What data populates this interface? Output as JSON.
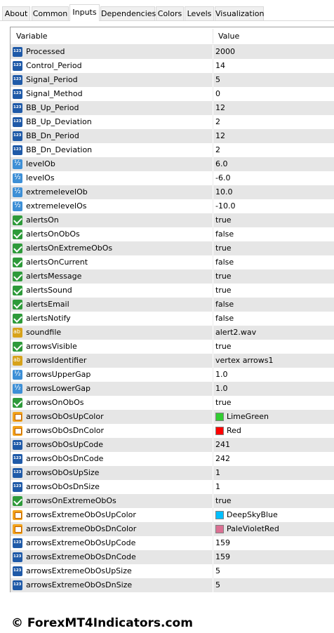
{
  "tabs": [
    {
      "label": "About",
      "active": false
    },
    {
      "label": "Common",
      "active": false
    },
    {
      "label": "Inputs",
      "active": true
    },
    {
      "label": "Dependencies",
      "active": false
    },
    {
      "label": "Colors",
      "active": false
    },
    {
      "label": "Levels",
      "active": false
    },
    {
      "label": "Visualization",
      "active": false
    }
  ],
  "table": {
    "headers": {
      "variable": "Variable",
      "value": "Value"
    },
    "rows": [
      {
        "type": "int",
        "name": "Processed",
        "value": "2000"
      },
      {
        "type": "int",
        "name": "Control_Period",
        "value": "14"
      },
      {
        "type": "int",
        "name": "Signal_Period",
        "value": "5"
      },
      {
        "type": "int",
        "name": "Signal_Method",
        "value": "0"
      },
      {
        "type": "int",
        "name": "BB_Up_Period",
        "value": "12"
      },
      {
        "type": "int",
        "name": "BB_Up_Deviation",
        "value": "2"
      },
      {
        "type": "int",
        "name": "BB_Dn_Period",
        "value": "12"
      },
      {
        "type": "int",
        "name": "BB_Dn_Deviation",
        "value": "2"
      },
      {
        "type": "double",
        "name": "levelOb",
        "value": "6.0"
      },
      {
        "type": "double",
        "name": "levelOs",
        "value": "-6.0"
      },
      {
        "type": "double",
        "name": "extremelevelOb",
        "value": "10.0"
      },
      {
        "type": "double",
        "name": "extremelevelOs",
        "value": "-10.0"
      },
      {
        "type": "bool",
        "name": "alertsOn",
        "value": "true"
      },
      {
        "type": "bool",
        "name": "alertsOnObOs",
        "value": "false"
      },
      {
        "type": "bool",
        "name": "alertsOnExtremeObOs",
        "value": "true"
      },
      {
        "type": "bool",
        "name": "alertsOnCurrent",
        "value": "false"
      },
      {
        "type": "bool",
        "name": "alertsMessage",
        "value": "true"
      },
      {
        "type": "bool",
        "name": "alertsSound",
        "value": "true"
      },
      {
        "type": "bool",
        "name": "alertsEmail",
        "value": "false"
      },
      {
        "type": "bool",
        "name": "alertsNotify",
        "value": "false"
      },
      {
        "type": "string",
        "name": "soundfile",
        "value": "alert2.wav"
      },
      {
        "type": "bool",
        "name": "arrowsVisible",
        "value": "true"
      },
      {
        "type": "string",
        "name": "arrowsIdentifier",
        "value": "vertex arrows1"
      },
      {
        "type": "double",
        "name": "arrowsUpperGap",
        "value": "1.0"
      },
      {
        "type": "double",
        "name": "arrowsLowerGap",
        "value": "1.0"
      },
      {
        "type": "bool",
        "name": "arrowsOnObOs",
        "value": "true"
      },
      {
        "type": "color",
        "name": "arrowsObOsUpColor",
        "value": "LimeGreen",
        "swatch": "#32cd32"
      },
      {
        "type": "color",
        "name": "arrowsObOsDnColor",
        "value": "Red",
        "swatch": "#ff0000"
      },
      {
        "type": "int",
        "name": "arrowsObOsUpCode",
        "value": "241"
      },
      {
        "type": "int",
        "name": "arrowsObOsDnCode",
        "value": "242"
      },
      {
        "type": "int",
        "name": "arrowsObOsUpSize",
        "value": "1"
      },
      {
        "type": "int",
        "name": "arrowsObOsDnSize",
        "value": "1"
      },
      {
        "type": "bool",
        "name": "arrowsOnExtremeObOs",
        "value": "true"
      },
      {
        "type": "color",
        "name": "arrowsExtremeObOsUpColor",
        "value": "DeepSkyBlue",
        "swatch": "#00bfff"
      },
      {
        "type": "color",
        "name": "arrowsExtremeObOsDnColor",
        "value": "PaleVioletRed",
        "swatch": "#db7093"
      },
      {
        "type": "int",
        "name": "arrowsExtremeObOsUpCode",
        "value": "159"
      },
      {
        "type": "int",
        "name": "arrowsExtremeObOsDnCode",
        "value": "159"
      },
      {
        "type": "int",
        "name": "arrowsExtremeObOsUpSize",
        "value": "5"
      },
      {
        "type": "int",
        "name": "arrowsExtremeObOsDnSize",
        "value": "5"
      }
    ]
  },
  "footer": {
    "text": "© ForexMT4Indicators.com"
  }
}
